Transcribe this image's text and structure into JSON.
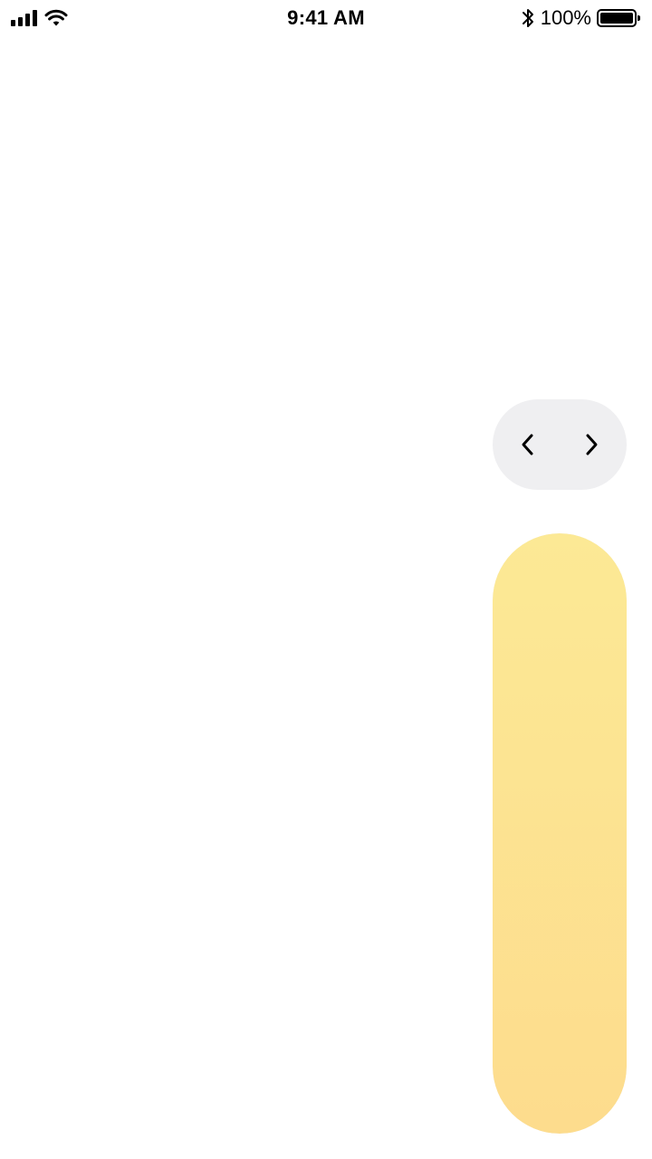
{
  "status_bar": {
    "time": "9:41 AM",
    "battery_percent": "100%",
    "icons": [
      "signal-icon",
      "wifi-icon",
      "bluetooth-icon",
      "battery-icon"
    ]
  },
  "pager": {
    "previous_icon": "chevron-left-icon",
    "next_icon": "chevron-right-icon"
  },
  "level_slider": {
    "level": 1.0,
    "gradient_top": "#fce995",
    "gradient_bottom": "#fddc8d"
  },
  "colors": {
    "background": "#ffffff",
    "pager_background": "#efeff1"
  }
}
